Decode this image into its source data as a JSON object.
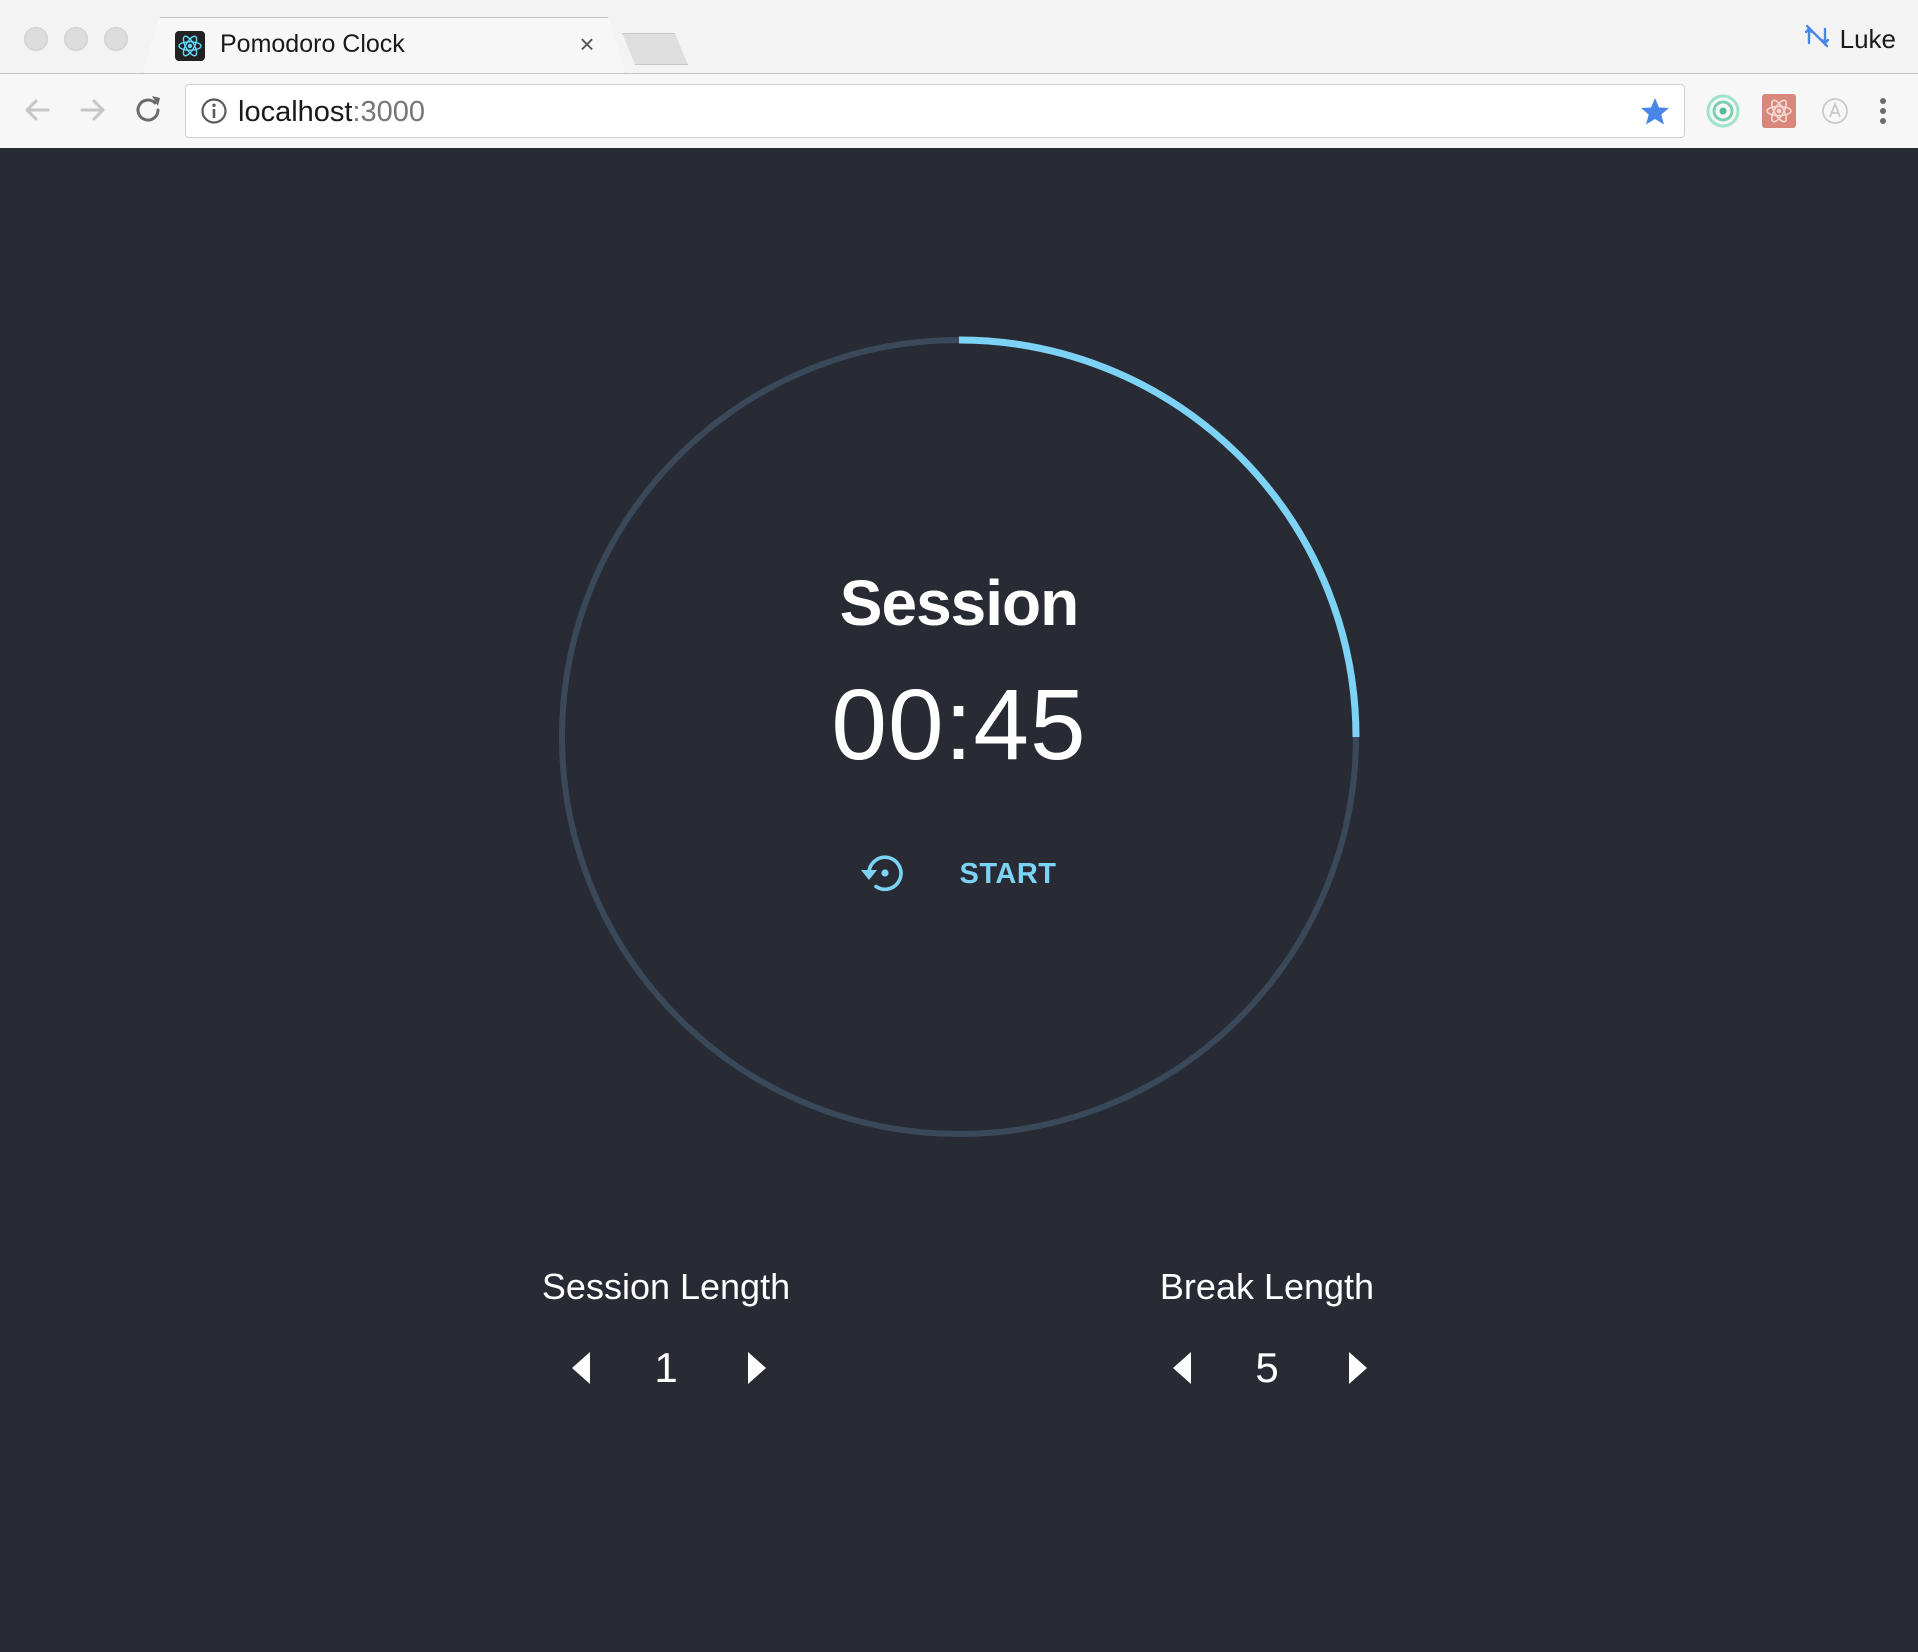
{
  "browser": {
    "tab": {
      "title": "Pomodoro Clock",
      "close_glyph": "×"
    },
    "profile": {
      "name": "Luke"
    },
    "omnibox": {
      "host": "localhost",
      "port": ":3000"
    },
    "icons": {
      "favicon": "react-logo-icon",
      "back": "back-arrow-icon",
      "forward": "forward-arrow-icon",
      "reload": "reload-icon",
      "info": "info-icon",
      "bookmark": "star-icon",
      "menu": "kebab-menu-icon"
    }
  },
  "timer": {
    "title": "Session",
    "time": "00:45",
    "start_label": "START",
    "progress_fraction": 0.25,
    "reset_icon": "reset-icon"
  },
  "controls": {
    "session": {
      "label": "Session Length",
      "value": "1"
    },
    "break": {
      "label": "Break Length",
      "value": "5"
    }
  },
  "colors": {
    "page_bg": "#282b34",
    "ring_track": "#39495a",
    "ring_progress": "#7dd3f5",
    "accent": "#7dd3f5",
    "text": "#ffffff",
    "bookmark_star": "#4a86e8"
  }
}
